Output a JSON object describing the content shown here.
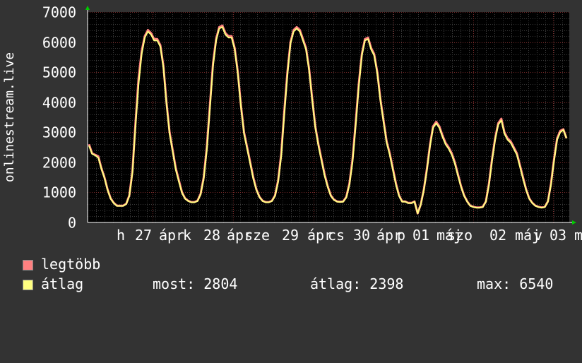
{
  "chart_data": {
    "type": "line",
    "ylabel": "onlinestream.live",
    "ylim": [
      0,
      7000
    ],
    "yticks": [
      "0",
      "1000",
      "2000",
      "3000",
      "4000",
      "5000",
      "6000",
      "7000"
    ],
    "xtick_labels": [
      "h",
      "27",
      "ápr",
      "k",
      "28",
      "ápr",
      "sze",
      "29",
      "ápr",
      "cs",
      "30",
      "ápr",
      "p",
      "01",
      "máj",
      "szo",
      "02",
      "máj",
      "v",
      "03",
      "m"
    ],
    "grid": true,
    "series": [
      {
        "name": "legtöbb",
        "color": "#ff8080",
        "values": [
          2600,
          2300,
          2250,
          2200,
          1800,
          1500,
          1100,
          800,
          650,
          560,
          560,
          560,
          620,
          900,
          1700,
          3300,
          4800,
          5700,
          6200,
          6400,
          6300,
          6100,
          6100,
          5900,
          5200,
          4000,
          3000,
          2400,
          1800,
          1400,
          1000,
          800,
          720,
          680,
          680,
          720,
          950,
          1500,
          2500,
          3900,
          5300,
          6100,
          6500,
          6550,
          6300,
          6200,
          6200,
          5800,
          5000,
          3900,
          3000,
          2500,
          2000,
          1500,
          1100,
          850,
          720,
          680,
          680,
          720,
          900,
          1400,
          2300,
          3700,
          5000,
          6000,
          6400,
          6500,
          6400,
          6100,
          5800,
          5100,
          4100,
          3200,
          2600,
          2100,
          1600,
          1200,
          900,
          760,
          700,
          690,
          700,
          850,
          1300,
          2100,
          3300,
          4600,
          5600,
          6100,
          6150,
          5800,
          5600,
          5000,
          4100,
          3400,
          2700,
          2300,
          1800,
          1300,
          900,
          700,
          700,
          650,
          650,
          700,
          300,
          600,
          1100,
          1800,
          2600,
          3200,
          3350,
          3200,
          2900,
          2650,
          2500,
          2300,
          2000,
          1600,
          1200,
          900,
          700,
          560,
          520,
          500,
          500,
          520,
          700,
          1300,
          2100,
          2800,
          3300,
          3450,
          3000,
          2800,
          2700,
          2500,
          2300,
          1900,
          1500,
          1100,
          800,
          650,
          560,
          520,
          500,
          520,
          700,
          1300,
          2100,
          2800,
          3050,
          3100,
          2800
        ]
      },
      {
        "name": "átlag",
        "color": "#ffff80",
        "values": [
          2550,
          2280,
          2230,
          2150,
          1780,
          1480,
          1080,
          790,
          640,
          550,
          550,
          550,
          610,
          880,
          1650,
          3200,
          4600,
          5600,
          6150,
          6350,
          6250,
          6050,
          6050,
          5850,
          5150,
          3950,
          2950,
          2350,
          1750,
          1350,
          980,
          790,
          710,
          670,
          670,
          710,
          930,
          1450,
          2400,
          3800,
          5200,
          6050,
          6450,
          6500,
          6250,
          6150,
          6150,
          5750,
          4950,
          3850,
          2950,
          2450,
          1950,
          1450,
          1080,
          840,
          710,
          670,
          670,
          710,
          880,
          1350,
          2200,
          3600,
          4900,
          5950,
          6350,
          6450,
          6350,
          6050,
          5750,
          5050,
          4050,
          3150,
          2550,
          2050,
          1550,
          1180,
          880,
          750,
          690,
          680,
          690,
          830,
          1250,
          2000,
          3200,
          4500,
          5550,
          6050,
          6100,
          5750,
          5550,
          4950,
          4050,
          3350,
          2650,
          2250,
          1750,
          1250,
          880,
          690,
          690,
          640,
          640,
          690,
          300,
          590,
          1080,
          1750,
          2550,
          3150,
          3300,
          3150,
          2850,
          2600,
          2450,
          2250,
          1950,
          1550,
          1180,
          880,
          690,
          550,
          510,
          490,
          490,
          510,
          690,
          1250,
          2050,
          2750,
          3250,
          3400,
          2950,
          2750,
          2650,
          2450,
          2250,
          1850,
          1450,
          1080,
          790,
          640,
          550,
          510,
          490,
          510,
          690,
          1250,
          2050,
          2750,
          3000,
          3080,
          2804
        ]
      }
    ]
  },
  "legend": {
    "max_label": "legtöbb",
    "avg_label": "átlag",
    "max_color": "#ff8080",
    "avg_color": "#ffff80"
  },
  "stats": {
    "most": "most: 2804",
    "atlag": "átlag: 2398",
    "max": "max: 6540"
  }
}
